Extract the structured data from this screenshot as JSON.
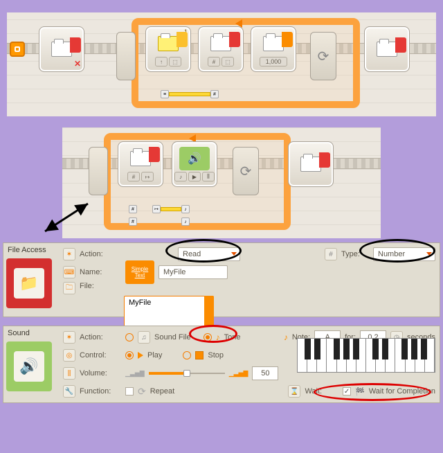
{
  "blocks": {
    "timer_value": "1,000",
    "loop_badge": "1"
  },
  "file_panel": {
    "title": "File Access",
    "action_label": "Action:",
    "action_value": "Read",
    "type_label": "Type:",
    "type_value": "Number",
    "name_label": "Name:",
    "simple_btn_l1": "Simple",
    "simple_btn_l2": "Text",
    "name_value": "MyFile",
    "file_label": "File:",
    "file_value": "MyFile"
  },
  "sound_panel": {
    "title": "Sound",
    "action_label": "Action:",
    "opt_soundfile": "Sound File",
    "opt_tone": "Tone",
    "note_label": "Note:",
    "note_value": "A",
    "for_label": "for:",
    "for_value": "0,2",
    "seconds_label": "seconds",
    "control_label": "Control:",
    "opt_play": "Play",
    "opt_stop": "Stop",
    "volume_label": "Volume:",
    "volume_value": "50",
    "function_label": "Function:",
    "repeat_label": "Repeat",
    "wait_label": "Wait:",
    "wait_completion": "Wait for Completion"
  }
}
